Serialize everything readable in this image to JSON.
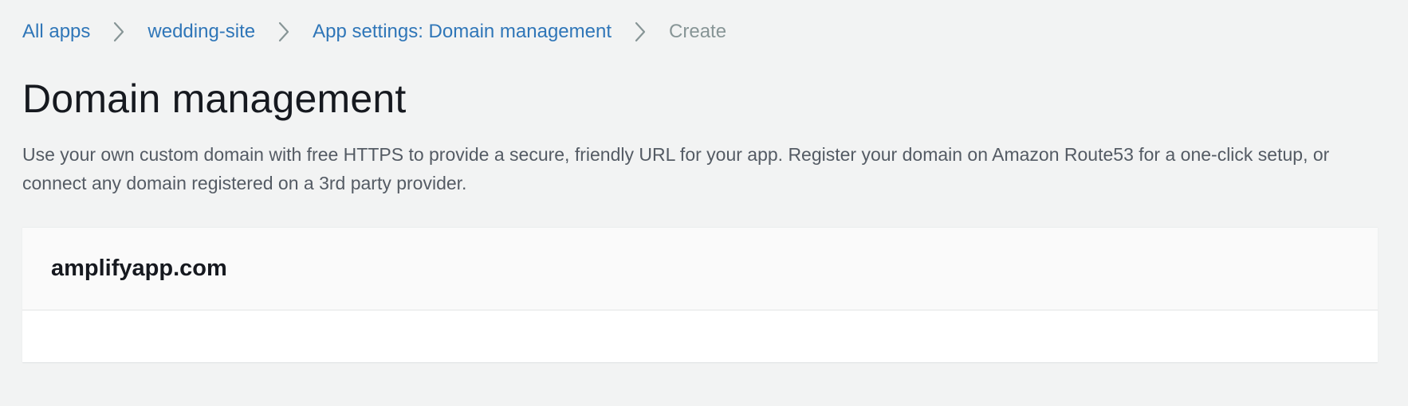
{
  "breadcrumb": {
    "items": [
      {
        "label": "All apps"
      },
      {
        "label": "wedding-site"
      },
      {
        "label": "App settings: Domain management"
      },
      {
        "label": "Create"
      }
    ],
    "separator_icon": "chevron-right-icon"
  },
  "page": {
    "title": "Domain management",
    "description": "Use your own custom domain with free HTTPS to provide a secure, friendly URL for your app. Register your domain on Amazon Route53 for a one-click setup, or connect any domain registered on a 3rd party provider."
  },
  "panel": {
    "title": "amplifyapp.com"
  },
  "colors": {
    "link": "#2f76b8",
    "current_crumb": "#879596",
    "background": "#f2f3f3",
    "text": "#16191f",
    "secondary_text": "#545b64"
  }
}
